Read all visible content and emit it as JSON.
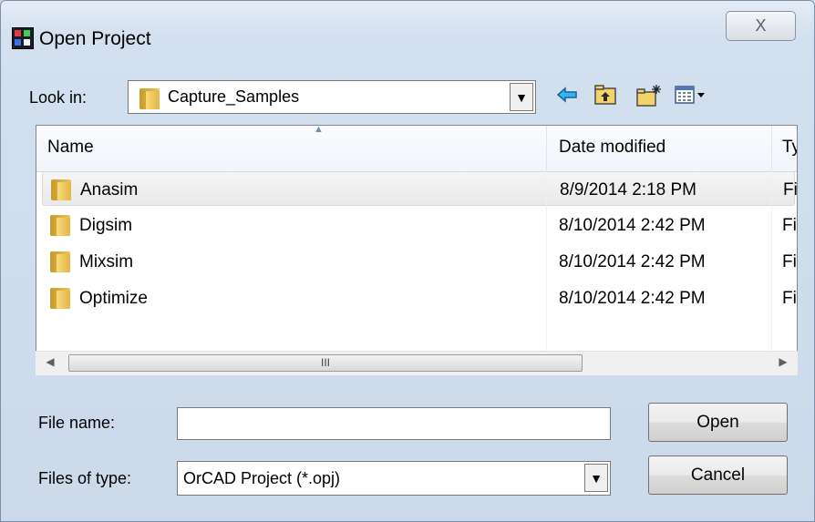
{
  "window": {
    "title": "Open Project",
    "close_glyph": "X"
  },
  "look_in": {
    "label": "Look in:",
    "value": "Capture_Samples",
    "arrow_glyph": "▼"
  },
  "toolbar": {
    "icons": [
      "back-arrow-icon",
      "up-folder-icon",
      "new-folder-icon",
      "view-menu-icon"
    ]
  },
  "list": {
    "columns": [
      "Name",
      "Date modified",
      "Ty"
    ],
    "sort_indicator": "▲",
    "rows": [
      {
        "name": "Anasim",
        "date": "8/9/2014 2:18 PM",
        "type": "Fi"
      },
      {
        "name": "Digsim",
        "date": "8/10/2014 2:42 PM",
        "type": "Fi"
      },
      {
        "name": "Mixsim",
        "date": "8/10/2014 2:42 PM",
        "type": "Fi"
      },
      {
        "name": "Optimize",
        "date": "8/10/2014 2:42 PM",
        "type": "Fi"
      }
    ],
    "selected_index": 0,
    "scroll_left_glyph": "◀",
    "scroll_right_glyph": "▶",
    "thumb_grip": "III"
  },
  "file_name": {
    "label": "File name:",
    "value": ""
  },
  "file_type": {
    "label": "Files of type:",
    "value": "OrCAD Project (*.opj)",
    "arrow_glyph": "▼"
  },
  "buttons": {
    "open": "Open",
    "cancel": "Cancel"
  },
  "colors": {
    "folder": "#e9c55a",
    "accent_blue": "#1a6fcf"
  }
}
